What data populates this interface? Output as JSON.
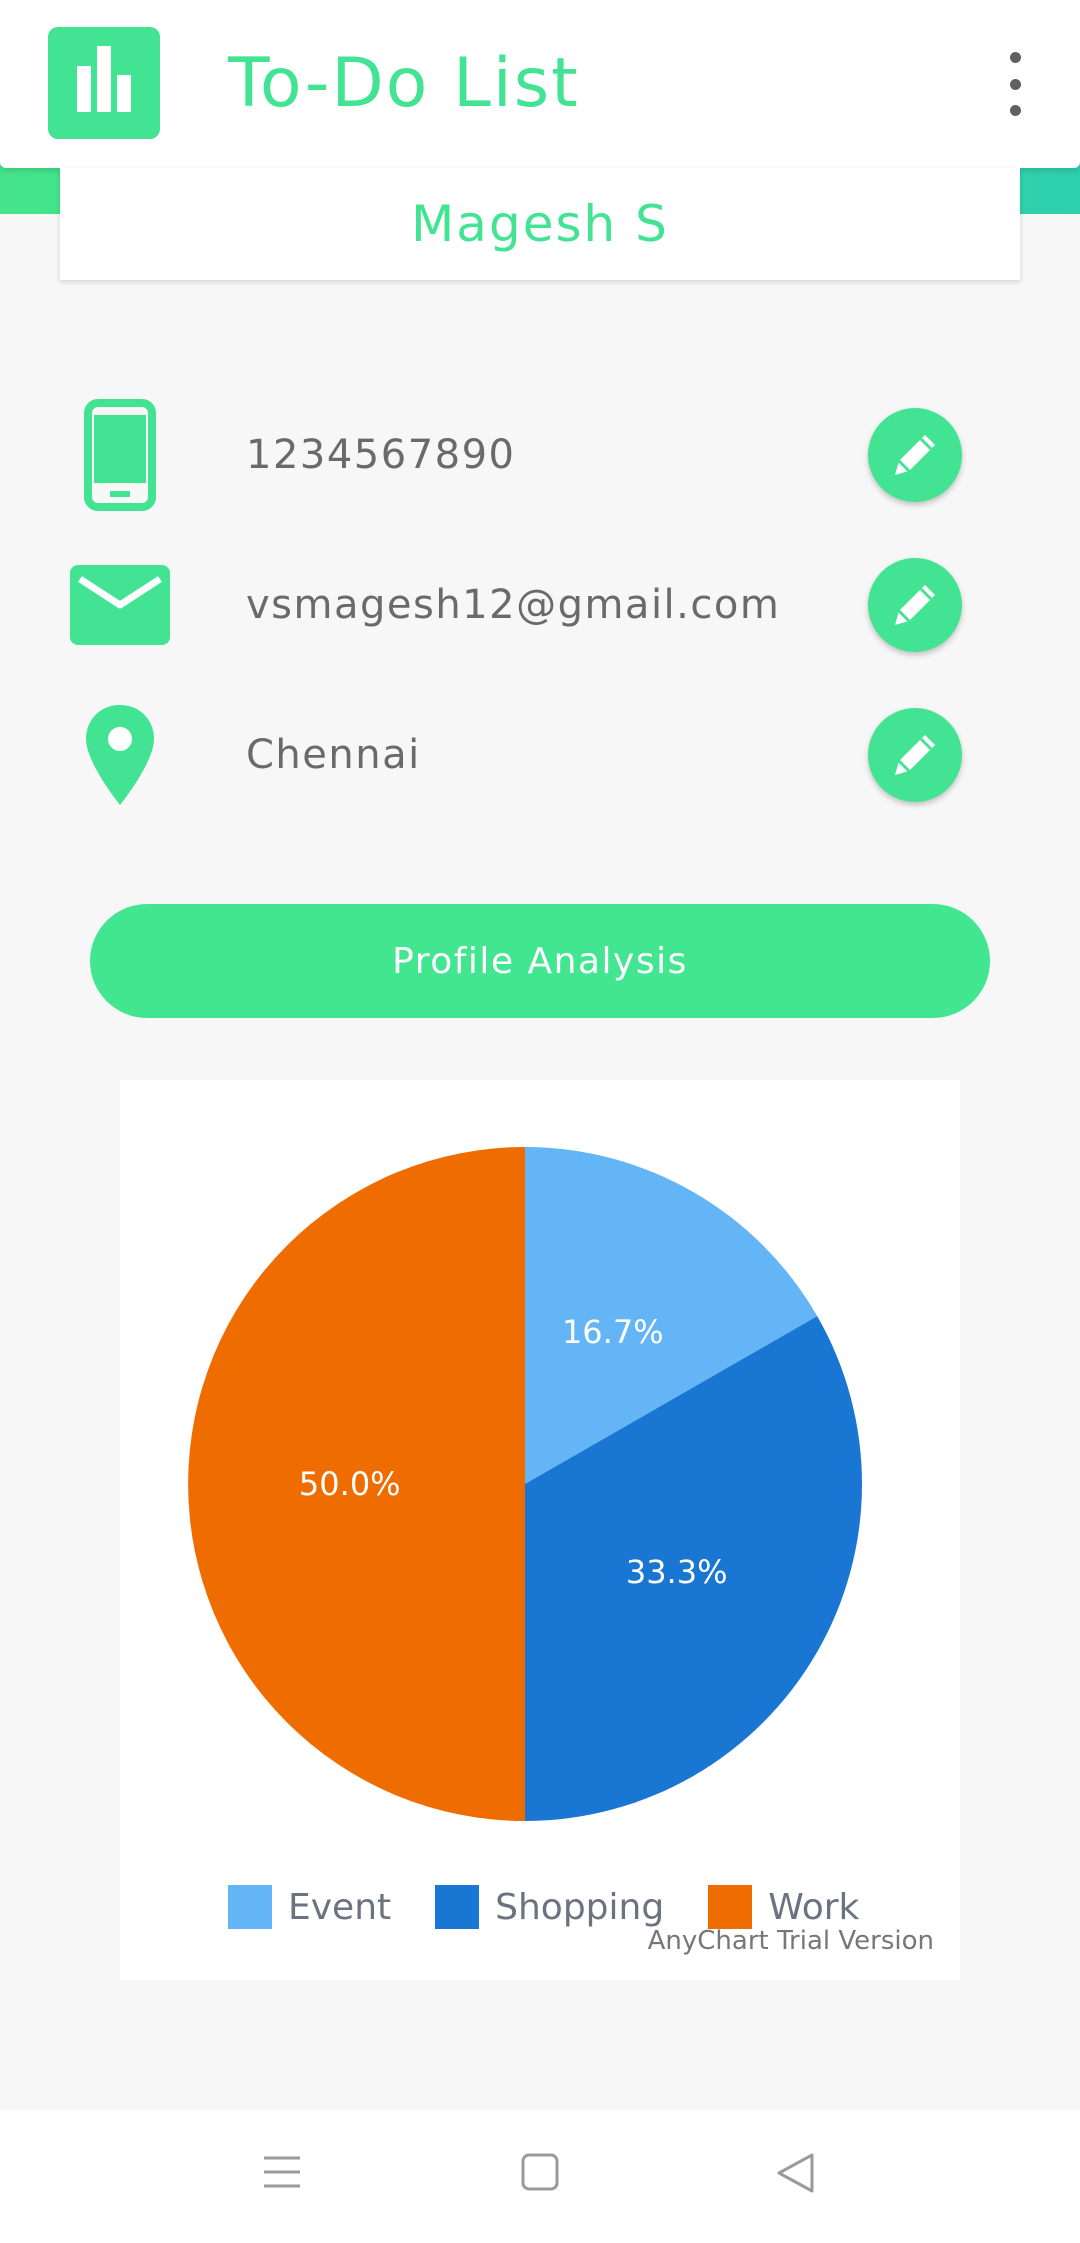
{
  "app": {
    "title": "To-Do List",
    "accent_color": "#42e493",
    "logo_icon": "bar-chart-icon",
    "menu_icon": "more-vert-icon"
  },
  "profile": {
    "name": "Magesh S",
    "details": [
      {
        "icon": "phone-icon",
        "value": "1234567890",
        "action_icon": "pencil-icon"
      },
      {
        "icon": "email-icon",
        "value": "vsmagesh12@gmail.com",
        "action_icon": "pencil-icon"
      },
      {
        "icon": "location-pin-icon",
        "value": "Chennai",
        "action_icon": "pencil-icon"
      }
    ]
  },
  "analysis_button": {
    "label": "Profile Analysis"
  },
  "chart_data": {
    "type": "pie",
    "categories": [
      "Event",
      "Shopping",
      "Work"
    ],
    "values": [
      16.7,
      33.3,
      50.0
    ],
    "labels": [
      "16.7%",
      "33.3%",
      "50.0%"
    ],
    "colors": [
      "#64b5f6",
      "#1976d2",
      "#ef6c00"
    ],
    "legend_position": "bottom",
    "watermark": "AnyChart Trial Version"
  },
  "nav_bar": {
    "buttons": [
      {
        "icon": "menu-icon"
      },
      {
        "icon": "home-square-icon"
      },
      {
        "icon": "back-triangle-icon"
      }
    ]
  }
}
